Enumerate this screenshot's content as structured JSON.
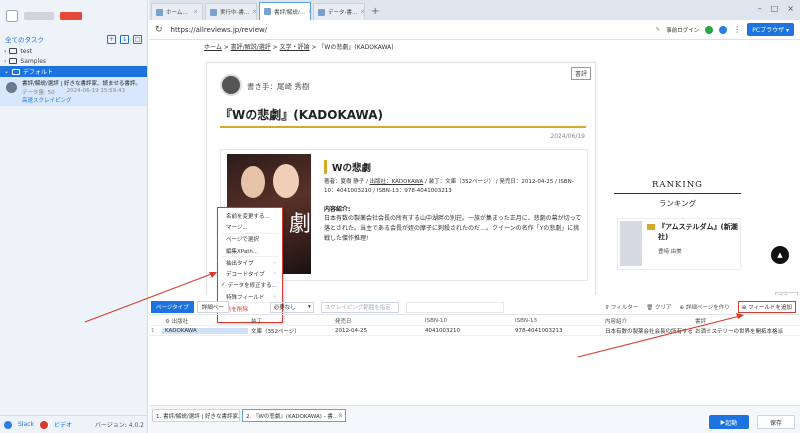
{
  "sidebar": {
    "header": "全てのタスク",
    "tree": [
      {
        "label": "test"
      },
      {
        "label": "Samples"
      },
      {
        "label": "デフォルト"
      }
    ],
    "task": {
      "title": "書評/解説/選評 | 好きな書評家、読ませる書評。",
      "meta_label": "データ量:",
      "meta_value": "50",
      "timestamp": "2024-06-19 15:59:43",
      "link": "高速スクレイピング"
    },
    "footer": {
      "icon1": "Slack",
      "icon2": "ビデオ",
      "version": "バージョン: 4.0.2"
    }
  },
  "tabs": [
    {
      "label": "ホーム..."
    },
    {
      "label": "実行中-書..."
    },
    {
      "label": "書評/解説/..."
    },
    {
      "label": "データ-書..."
    }
  ],
  "address": {
    "url": "https://allreviews.jp/review/",
    "login": "事前ログイン",
    "browser": "PCブラウザ"
  },
  "web": {
    "breadcrumb": [
      "ホーム",
      "書評/解説/選評",
      "文学・評論",
      "『Wの悲劇』(KADOKAWA)"
    ],
    "badge": "書評",
    "author": "書き手：尾崎 秀樹",
    "title": "『Wの悲劇』(KADOKAWA)",
    "date": "2024/06/19",
    "cover_text": "劇",
    "book": {
      "title": "Wの悲劇",
      "meta_prefix": "著者：夏樹 静子 / ",
      "meta_publisher": "出版社：KADOKAWA",
      "meta_rest": " / 装丁：文庫（352ページ） / 発売日：2012-04-25 / ISBN-10：4041003210 / ISBN-13：978-4041003213",
      "desc_head": "内容紹介:",
      "desc": "日本有数の製薬会社会長の所有する山中湖畔の別荘。一族が集まった正月に、悲劇の幕が切って落とされた。当主である会長が姪の摩子に刺殺されたのだ…。クイーンの名作「Yの悲劇」に挑戦した傑作推理!"
    },
    "ranking": {
      "title": "RANKING",
      "sub": "ランキング",
      "item_name": "『アムステルダム』(新潮社)",
      "item_author": "豊﨑 由美"
    },
    "collapse": "折る"
  },
  "context_menu": [
    {
      "label": "名前を変更する..."
    },
    {
      "label": "マージ..."
    },
    {
      "label": "ページで選択"
    },
    {
      "label": "編集XPath..."
    },
    {
      "label": "抽出タイプ"
    },
    {
      "label": "デコードタイプ"
    },
    {
      "label": "データを修正する..."
    },
    {
      "label": "特殊フィールド"
    },
    {
      "label": "列を削除"
    }
  ],
  "toolbar": {
    "tab1": "ページタイプ",
    "tab2": "詳細ペー",
    "select": "必要なし",
    "scroll": "スクレイピング範囲を指定",
    "filter": "フィルター",
    "clear": "クリア",
    "detail": "詳細ページを作り",
    "add_field": "フィールドを追加"
  },
  "grid": {
    "headers": [
      "出版社",
      "装丁",
      "発売日",
      "ISBN-10",
      "ISBN-13",
      "内容紹介",
      "書評"
    ],
    "rows": [
      [
        "1",
        "KADOKAWA",
        "文庫（352ページ）",
        "2012-04-25",
        "4041003210",
        "978-4041003213",
        "日本有数の製薬会社会長の所有する山",
        "お洒ミステリーの世界を開拓本格派"
      ]
    ]
  },
  "bottom": {
    "tab1": "1. 書評/解説/選評 | 好きな書評家、",
    "tab2": "2. 『Wの悲劇』(KADOKAWA) - 書...",
    "start": "起動",
    "save": "保存"
  },
  "colors": {
    "accent": "#1d74e0",
    "highlight": "#d63a2e",
    "gold": "#d8a928"
  }
}
